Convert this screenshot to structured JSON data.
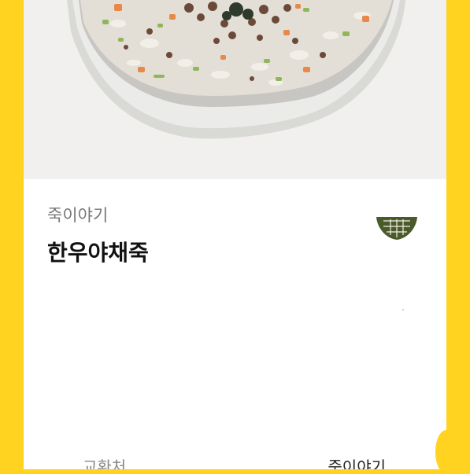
{
  "product": {
    "brand": "죽이야기",
    "name": "한우야채죽",
    "photo_icon": "porridge-bowl-image",
    "logo_icon": "brand-logo-bowl"
  },
  "exchange": {
    "label": "교환처",
    "value": "죽이야기"
  },
  "colors": {
    "background": "#ffd31f",
    "card": "#ffffff",
    "logo": "#4a5a2a"
  }
}
